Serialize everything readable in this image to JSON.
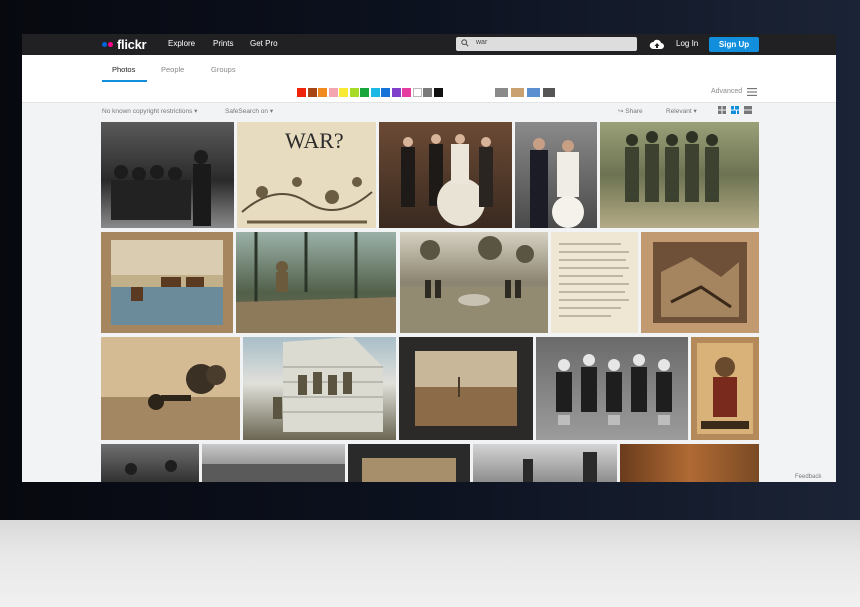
{
  "brand": {
    "name": "flickr",
    "dot_colors": [
      "#0063dc",
      "#ff0084"
    ]
  },
  "topnav": {
    "links": [
      "Explore",
      "Prints",
      "Get Pro"
    ],
    "search_value": "war",
    "login": "Log In",
    "signup": "Sign Up"
  },
  "subnav": {
    "tabs": [
      "Photos",
      "People",
      "Groups"
    ],
    "active_tab": "Photos"
  },
  "colors": {
    "swatches": [
      "#f0240a",
      "#a64614",
      "#f28b1e",
      "#f4a6b0",
      "#f9ea32",
      "#a8db27",
      "#17a53d",
      "#1cb9e4",
      "#1674d9",
      "#7f3fcb",
      "#e63ca0",
      "#ffffff",
      "#7a7a7a",
      "#111111"
    ],
    "accent": "#128fdc",
    "nav_bg": "#212124"
  },
  "advanced": "Advanced",
  "filters": {
    "license": "No known copyright restrictions",
    "safesearch": "SafeSearch on",
    "share": "Share",
    "sort": "Relevant"
  },
  "photos": {
    "row1": [
      "war-crowd-bw",
      "war-cartoon-sketch",
      "wedding-group",
      "wedding-couple",
      "soldiers-group"
    ],
    "row2": [
      "horses-painting",
      "forest-soldiers",
      "memorial-field",
      "handwritten-letter",
      "battlefield-sepia"
    ],
    "row3": [
      "cannon-smoke",
      "house-soldiers",
      "landscape-dark-frame",
      "children-refugees",
      "war-poster"
    ],
    "row4": [
      "street-scene",
      "field-bw",
      "dark-frame",
      "city-soldiers",
      "fire-orange"
    ]
  },
  "poster_text": "WAR?",
  "feedback": "Feedback"
}
